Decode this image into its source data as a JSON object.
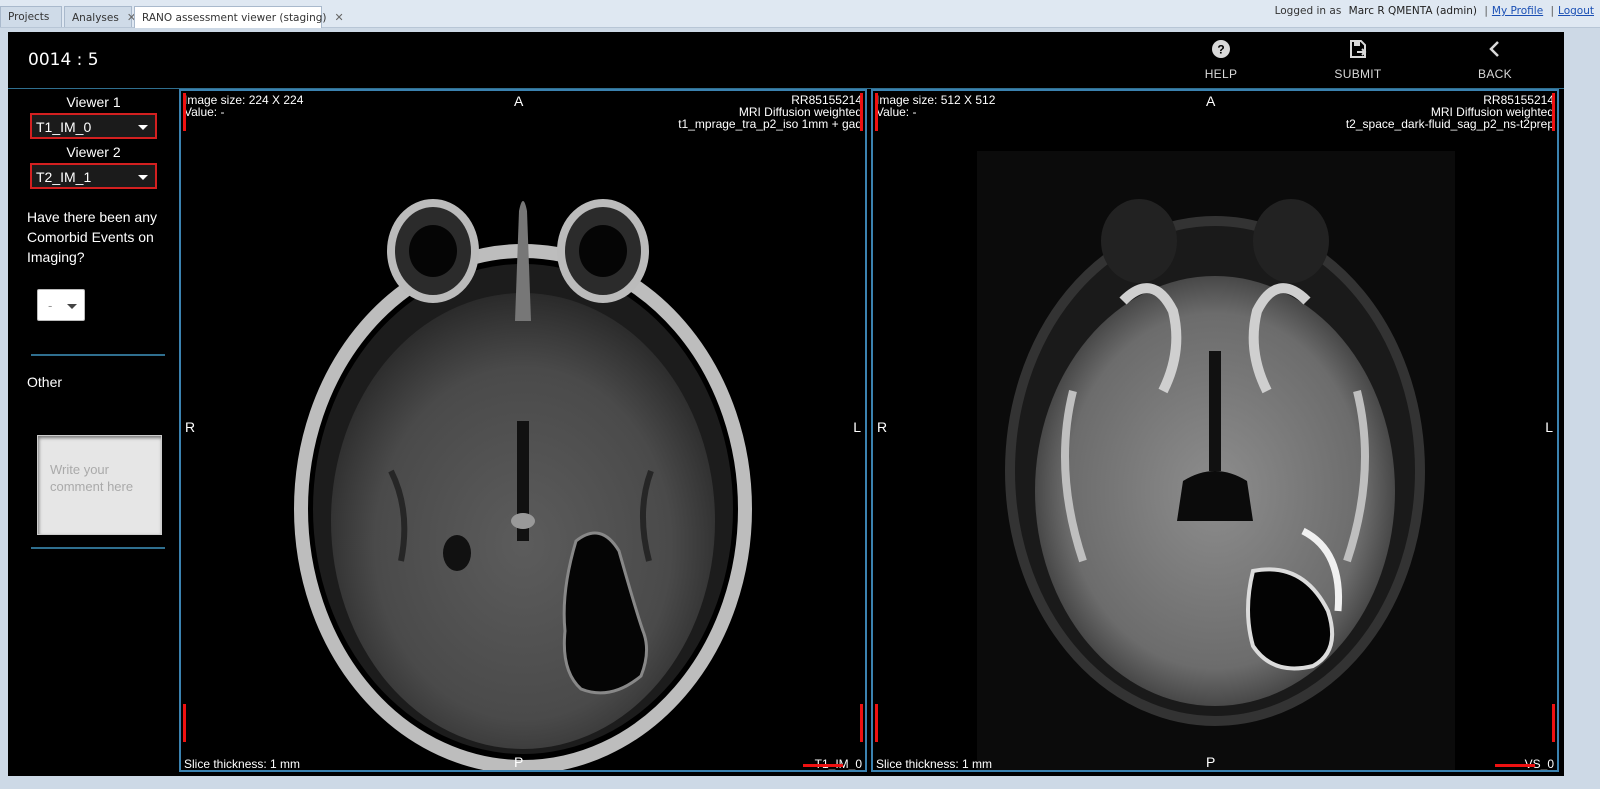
{
  "tabs": [
    {
      "label": "Projects",
      "closable": false
    },
    {
      "label": "Analyses",
      "closable": true
    },
    {
      "label": "RANO assessment viewer (staging)",
      "closable": true
    }
  ],
  "userbar": {
    "prefix": "Logged in as",
    "user": "Marc R QMENTA (admin)",
    "separator": "|",
    "profile_link": "My Profile",
    "logout_link": "Logout"
  },
  "header": {
    "subject_id": "0014 : 5",
    "buttons": [
      {
        "label": "HELP",
        "icon": "help-icon"
      },
      {
        "label": "SUBMIT",
        "icon": "submit-icon"
      },
      {
        "label": "BACK",
        "icon": "back-icon"
      }
    ]
  },
  "sidebar": {
    "viewer1_label": "Viewer 1",
    "viewer1_value": "T1_IM_0",
    "viewer2_label": "Viewer 2",
    "viewer2_value": "T2_IM_1",
    "question": "Have there been any Comorbid Events on Imaging?",
    "comorbid_value": "-",
    "other_label": "Other",
    "comment_placeholder": "Write your comment here"
  },
  "viewers": [
    {
      "image_size": "Image size: 224 X 224",
      "value": "Value: -",
      "id": "RR85155214",
      "modality": "MRI Diffusion weighted",
      "sequence": "t1_mprage_tra_p2_iso 1mm + gad",
      "slice_thickness": "Slice thickness: 1 mm",
      "series_label": "T1_IM_0",
      "orient": {
        "top": "A",
        "left": "R",
        "right": "L",
        "bottom": "P"
      }
    },
    {
      "image_size": "Image size: 512 X 512",
      "value": "Value: -",
      "id": "RR85155214",
      "modality": "MRI Diffusion weighted",
      "sequence": "t2_space_dark-fluid_sag_p2_ns-t2prep",
      "slice_thickness": "Slice thickness: 1 mm",
      "series_label": "VS_0",
      "orient": {
        "top": "A",
        "left": "R",
        "right": "L",
        "bottom": "P"
      }
    }
  ],
  "colors": {
    "accent_red": "#e11111",
    "border_blue": "#3b82b0",
    "background": "#000000"
  }
}
